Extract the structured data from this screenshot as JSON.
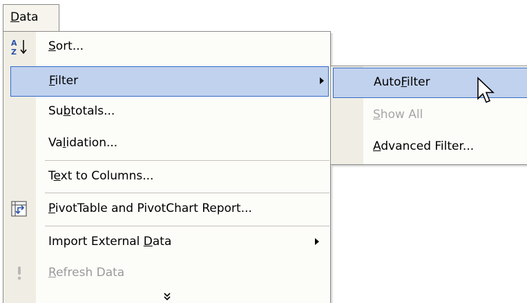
{
  "menubar": {
    "data_menu": {
      "pre": "",
      "mnemonic": "D",
      "post": "ata"
    }
  },
  "menu": {
    "items": [
      {
        "pre": "",
        "mnemonic": "S",
        "post": "ort...",
        "icon": "sort-ascending-icon"
      },
      {
        "pre": "",
        "mnemonic": "F",
        "post": "ilter",
        "submenu": true,
        "highlighted": true
      },
      {
        "pre": "Su",
        "mnemonic": "b",
        "post": "totals..."
      },
      {
        "pre": "Va",
        "mnemonic": "l",
        "post": "idation..."
      },
      {
        "pre": "T",
        "mnemonic": "e",
        "post": "xt to Columns..."
      },
      {
        "pre": "",
        "mnemonic": "P",
        "post": "ivotTable and PivotChart Report...",
        "icon": "pivottable-icon"
      },
      {
        "pre": "Import External ",
        "mnemonic": "D",
        "post": "ata",
        "submenu": true
      },
      {
        "pre": "",
        "mnemonic": "R",
        "post": "efresh Data",
        "disabled": true,
        "icon": "refresh-exclamation-icon"
      }
    ],
    "expand_glyph": "»",
    "expand_icon": "expand-chevrons-icon"
  },
  "filter_submenu": {
    "items": [
      {
        "pre": "Auto",
        "mnemonic": "F",
        "post": "ilter",
        "highlighted": true
      },
      {
        "pre": "",
        "mnemonic": "S",
        "post": "how All",
        "disabled": true
      },
      {
        "pre": "",
        "mnemonic": "A",
        "post": "dvanced Filter..."
      }
    ]
  },
  "colors": {
    "highlight_fill": "#c1d2ee",
    "highlight_border": "#316ac5",
    "gutter": "#f0eee4",
    "disabled_text": "#9a9a9a"
  }
}
